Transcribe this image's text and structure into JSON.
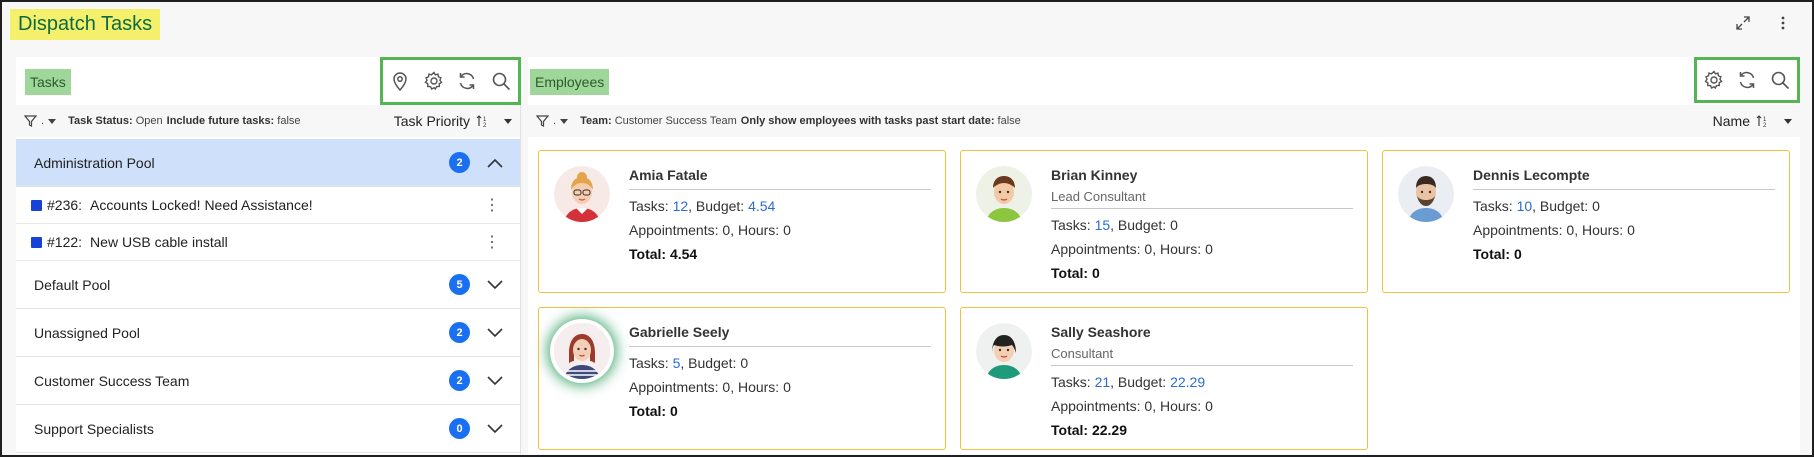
{
  "page": {
    "title": "Dispatch Tasks"
  },
  "top_actions": {
    "expand_icon": "expand-icon",
    "menu_icon": "kebab-menu-icon"
  },
  "tasks_panel": {
    "label": "Tasks",
    "tools": [
      "map-pin-icon",
      "gear-icon",
      "refresh-icon",
      "search-icon"
    ],
    "filter": {
      "filter_value": ".",
      "status_label": "Task Status:",
      "status_value": "Open",
      "future_label": "Include future tasks:",
      "future_value": "false"
    },
    "sort": {
      "label": "Task Priority"
    },
    "pools": [
      {
        "name": "Administration Pool",
        "count": "2",
        "expanded": true,
        "tasks": [
          {
            "number": "#236:",
            "title": "Accounts Locked! Need Assistance!",
            "color": "#1742d8"
          },
          {
            "number": "#122:",
            "title": "New USB cable install",
            "color": "#1742d8"
          }
        ]
      },
      {
        "name": "Default Pool",
        "count": "5",
        "expanded": false
      },
      {
        "name": "Unassigned Pool",
        "count": "2",
        "expanded": false
      },
      {
        "name": "Customer Success Team",
        "count": "2",
        "expanded": false
      },
      {
        "name": "Support Specialists",
        "count": "0",
        "expanded": false
      }
    ]
  },
  "employees_panel": {
    "label": "Employees",
    "tools": [
      "gear-icon",
      "refresh-icon",
      "search-icon"
    ],
    "filter": {
      "filter_value": ".",
      "team_label": "Team:",
      "team_value": "Customer Success Team",
      "past_label": "Only show employees with tasks past start date:",
      "past_value": "false"
    },
    "sort": {
      "label": "Name"
    },
    "employees": [
      {
        "name": "Amia Fatale",
        "title": "",
        "tasks": "12",
        "budget": "4.54",
        "appointments": "0",
        "hours": "0",
        "total": "4.54"
      },
      {
        "name": "Brian Kinney",
        "title": "Lead Consultant",
        "tasks": "15",
        "budget": "0",
        "appointments": "0",
        "hours": "0",
        "total": "0"
      },
      {
        "name": "Dennis Lecompte",
        "title": "",
        "tasks": "10",
        "budget": "0",
        "appointments": "0",
        "hours": "0",
        "total": "0"
      },
      {
        "name": "Gabrielle Seely",
        "title": "",
        "tasks": "5",
        "budget": "0",
        "appointments": "0",
        "hours": "0",
        "total": "0"
      },
      {
        "name": "Sally Seashore",
        "title": "Consultant",
        "tasks": "21",
        "budget": "22.29",
        "appointments": "0",
        "hours": "0",
        "total": "22.29"
      }
    ],
    "labels": {
      "tasks": "Tasks: ",
      "budget": ", Budget: ",
      "appointments": "Appointments: ",
      "hours": ", Hours: ",
      "total": "Total: "
    }
  },
  "colors": {
    "title_bg": "#f5f06b",
    "title_text": "#0d6a44",
    "panel_label_bg": "#9fd69a",
    "tool_border": "#55b454",
    "badge": "#1a6ff2",
    "active_pool": "#cfe0fb",
    "card_border": "#f0c23c",
    "link": "#2a6bd6"
  }
}
